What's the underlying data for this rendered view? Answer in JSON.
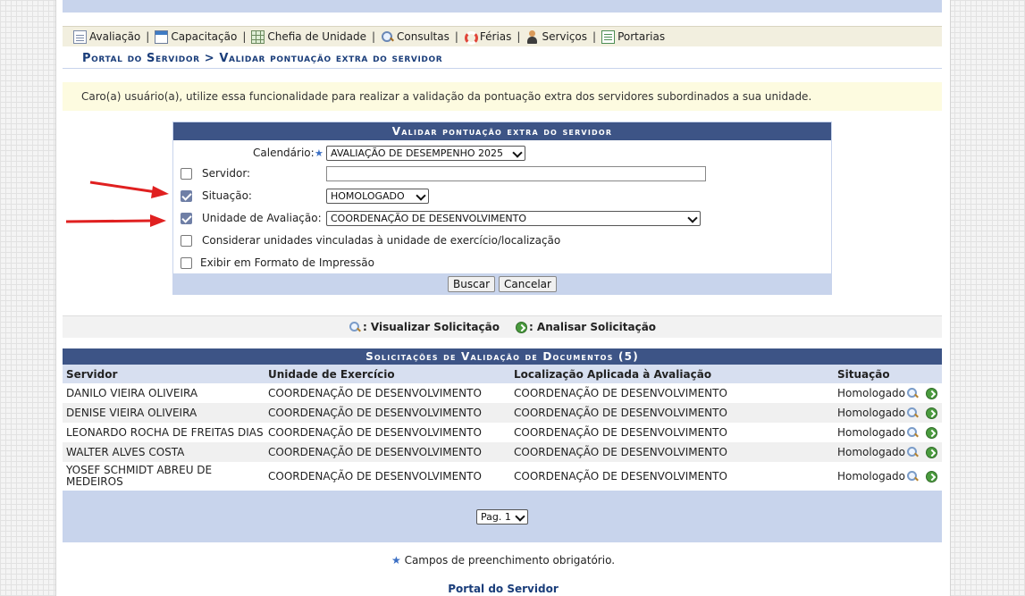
{
  "menu": [
    {
      "label": "Avaliação",
      "icon": "edit-document-icon"
    },
    {
      "label": "Capacitação",
      "icon": "calendar-form-icon"
    },
    {
      "label": "Chefia de Unidade",
      "icon": "grid-table-icon"
    },
    {
      "label": "Consultas",
      "icon": "search-icon"
    },
    {
      "label": "Férias",
      "icon": "lifebuoy-icon"
    },
    {
      "label": "Serviços",
      "icon": "user-icon"
    },
    {
      "label": "Portarias",
      "icon": "page-icon"
    }
  ],
  "breadcrumb": "Portal do Servidor > Validar pontuação extra do servidor",
  "notice": "Caro(a) usuário(a), utilize essa funcionalidade para realizar a validação da pontuação extra dos servidores subordinados a sua unidade.",
  "form": {
    "title": "Validar pontuação extra do servidor",
    "calendario_label": "Calendário:",
    "calendario_value": "AVALIAÇÃO DE DESEMPENHO 2025",
    "servidor_label": "Servidor:",
    "servidor_value": "",
    "situacao_label": "Situação:",
    "situacao_value": "HOMOLOGADO",
    "unidade_label": "Unidade de Avaliação:",
    "unidade_value": "COORDENAÇÃO DE DESENVOLVIMENTO",
    "vinculadas_label": "Considerar unidades vinculadas à unidade de exercício/localização",
    "impressao_label": "Exibir em Formato de Impressão",
    "checked": {
      "servidor": false,
      "situacao": true,
      "unidade": true,
      "vinculadas": false,
      "impressao": false
    },
    "buscar_label": "Buscar",
    "cancelar_label": "Cancelar"
  },
  "legend": {
    "visualizar": ": Visualizar Solicitação",
    "analisar": ": Analisar Solicitação"
  },
  "results": {
    "title": "Solicitações de Validação de Documentos (5)",
    "headers": [
      "Servidor",
      "Unidade de Exercício",
      "Localização Aplicada à Avaliação",
      "Situação"
    ],
    "rows": [
      {
        "servidor": "DANILO VIEIRA OLIVEIRA",
        "unidade": "COORDENAÇÃO DE DESENVOLVIMENTO",
        "localizacao": "COORDENAÇÃO DE DESENVOLVIMENTO",
        "situacao": "Homologado"
      },
      {
        "servidor": "DENISE VIEIRA OLIVEIRA",
        "unidade": "COORDENAÇÃO DE DESENVOLVIMENTO",
        "localizacao": "COORDENAÇÃO DE DESENVOLVIMENTO",
        "situacao": "Homologado"
      },
      {
        "servidor": "LEONARDO ROCHA DE FREITAS DIAS",
        "unidade": "COORDENAÇÃO DE DESENVOLVIMENTO",
        "localizacao": "COORDENAÇÃO DE DESENVOLVIMENTO",
        "situacao": "Homologado"
      },
      {
        "servidor": "WALTER ALVES COSTA",
        "unidade": "COORDENAÇÃO DE DESENVOLVIMENTO",
        "localizacao": "COORDENAÇÃO DE DESENVOLVIMENTO",
        "situacao": "Homologado"
      },
      {
        "servidor": "YOSEF SCHMIDT ABREU DE MEDEIROS",
        "unidade": "COORDENAÇÃO DE DESENVOLVIMENTO",
        "localizacao": "COORDENAÇÃO DE DESENVOLVIMENTO",
        "situacao": "Homologado"
      }
    ],
    "page_select": "Pag. 1"
  },
  "required_note": "Campos de preenchimento obrigatório.",
  "footer_link": "Portal do Servidor",
  "colors": {
    "header_blue": "#3d5486",
    "light_blue": "#c8d4ec",
    "annotation_red": "#e02020"
  }
}
